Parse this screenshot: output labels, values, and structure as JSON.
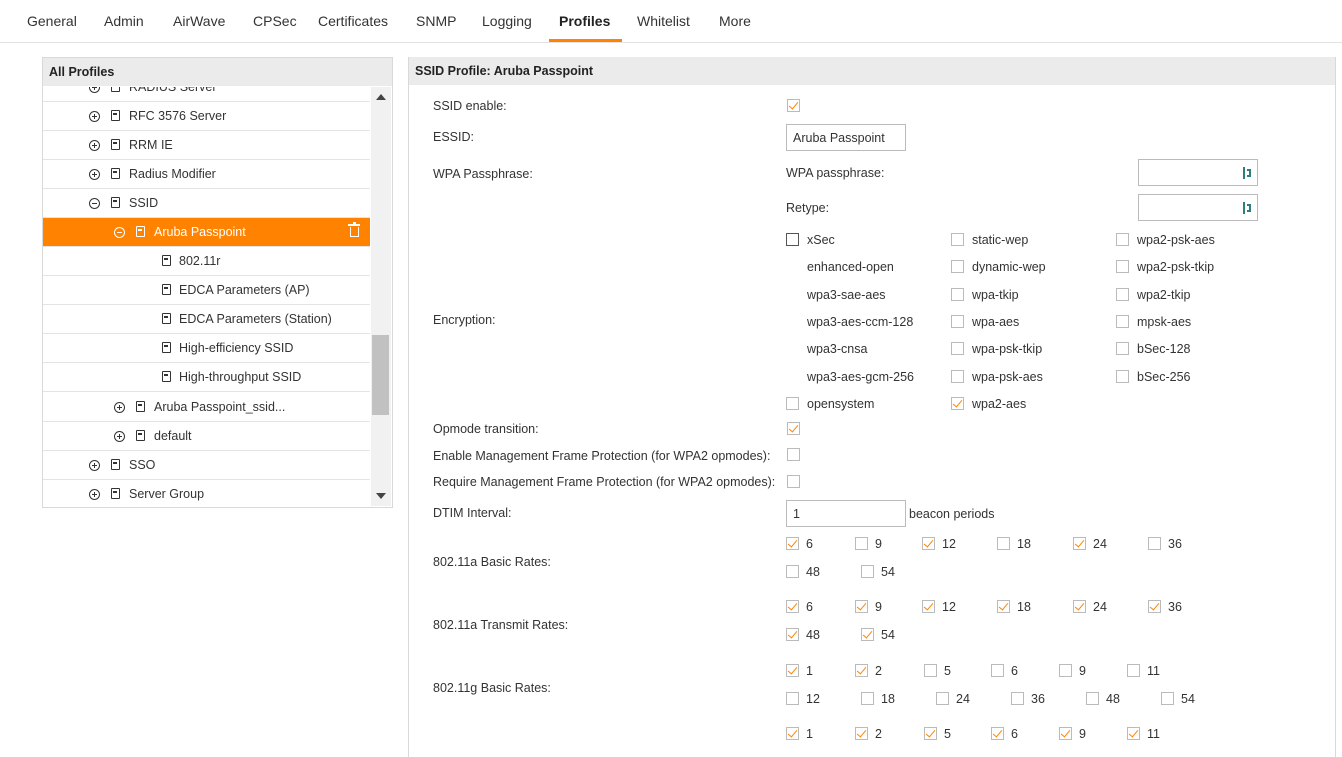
{
  "tabs": [
    "General",
    "Admin",
    "AirWave",
    "CPSec",
    "Certificates",
    "SNMP",
    "Logging",
    "Profiles",
    "Whitelist",
    "More"
  ],
  "active_tab": "Profiles",
  "colors": {
    "accent": "#ff8300",
    "check": "#ff8300",
    "panel_header": "#ebebeb"
  },
  "left_panel": {
    "title": "All Profiles",
    "tree": [
      {
        "label": "RADIUS Server",
        "expander": "plus",
        "partial": true
      },
      {
        "label": "RFC 3576 Server",
        "expander": "plus"
      },
      {
        "label": "RRM IE",
        "expander": "plus"
      },
      {
        "label": "Radius Modifier",
        "expander": "plus"
      },
      {
        "label": "SSID",
        "expander": "minus"
      },
      {
        "label": "Aruba Passpoint",
        "expander": "minus",
        "selected": true
      },
      {
        "label": "802.11r",
        "expander": "none"
      },
      {
        "label": "EDCA Parameters (AP)",
        "expander": "none"
      },
      {
        "label": "EDCA Parameters (Station)",
        "expander": "none"
      },
      {
        "label": "High-efficiency SSID",
        "expander": "none"
      },
      {
        "label": "High-throughput SSID",
        "expander": "none"
      },
      {
        "label": "Aruba Passpoint_ssid...",
        "expander": "plus"
      },
      {
        "label": "default",
        "expander": "plus"
      },
      {
        "label": "SSO",
        "expander": "plus"
      },
      {
        "label": "Server Group",
        "expander": "plus"
      }
    ]
  },
  "right_panel": {
    "title": "SSID Profile: Aruba Passpoint",
    "ssid_enable": {
      "label": "SSID enable:",
      "checked": true
    },
    "essid": {
      "label": "ESSID:",
      "value": "Aruba Passpoint"
    },
    "wpa": {
      "label": "WPA Passphrase:",
      "passphrase_label": "WPA passphrase:",
      "retype_label": "Retype:"
    },
    "encryption": {
      "label": "Encryption:",
      "options": [
        {
          "name": "xSec",
          "has_checkbox": true,
          "checked": false
        },
        {
          "name": "static-wep",
          "has_checkbox": true,
          "checked": false
        },
        {
          "name": "wpa2-psk-aes",
          "has_checkbox": true,
          "checked": false
        },
        {
          "name": "enhanced-open",
          "has_checkbox": false,
          "checked": false
        },
        {
          "name": "dynamic-wep",
          "has_checkbox": true,
          "checked": false
        },
        {
          "name": "wpa2-psk-tkip",
          "has_checkbox": true,
          "checked": false
        },
        {
          "name": "wpa3-sae-aes",
          "has_checkbox": false,
          "checked": false
        },
        {
          "name": "wpa-tkip",
          "has_checkbox": true,
          "checked": false
        },
        {
          "name": "wpa2-tkip",
          "has_checkbox": true,
          "checked": false
        },
        {
          "name": "wpa3-aes-ccm-128",
          "has_checkbox": false,
          "checked": false
        },
        {
          "name": "wpa-aes",
          "has_checkbox": true,
          "checked": false
        },
        {
          "name": "mpsk-aes",
          "has_checkbox": true,
          "checked": false
        },
        {
          "name": "wpa3-cnsa",
          "has_checkbox": false,
          "checked": false
        },
        {
          "name": "wpa-psk-tkip",
          "has_checkbox": true,
          "checked": false
        },
        {
          "name": "bSec-128",
          "has_checkbox": true,
          "checked": false
        },
        {
          "name": "wpa3-aes-gcm-256",
          "has_checkbox": false,
          "checked": false
        },
        {
          "name": "wpa-psk-aes",
          "has_checkbox": true,
          "checked": false
        },
        {
          "name": "bSec-256",
          "has_checkbox": true,
          "checked": false
        },
        {
          "name": "opensystem",
          "has_checkbox": true,
          "checked": false
        },
        {
          "name": "wpa2-aes",
          "has_checkbox": true,
          "checked": true
        }
      ]
    },
    "opmode_transition": {
      "label": "Opmode transition:",
      "checked": true
    },
    "mfp_enable": {
      "label": "Enable Management Frame Protection (for WPA2 opmodes):",
      "checked": false
    },
    "mfp_require": {
      "label": "Require Management Frame Protection (for WPA2 opmodes):",
      "checked": false
    },
    "dtim": {
      "label": "DTIM Interval:",
      "value": "1",
      "suffix": "beacon periods"
    },
    "a_basic": {
      "label": "802.11a Basic Rates:",
      "rates": [
        {
          "v": "6",
          "c": true
        },
        {
          "v": "9",
          "c": false
        },
        {
          "v": "12",
          "c": true
        },
        {
          "v": "18",
          "c": false
        },
        {
          "v": "24",
          "c": true
        },
        {
          "v": "36",
          "c": false
        },
        {
          "v": "48",
          "c": false
        },
        {
          "v": "54",
          "c": false
        }
      ]
    },
    "a_tx": {
      "label": "802.11a Transmit Rates:",
      "rates": [
        {
          "v": "6",
          "c": true
        },
        {
          "v": "9",
          "c": true
        },
        {
          "v": "12",
          "c": true
        },
        {
          "v": "18",
          "c": true
        },
        {
          "v": "24",
          "c": true
        },
        {
          "v": "36",
          "c": true
        },
        {
          "v": "48",
          "c": true
        },
        {
          "v": "54",
          "c": true
        }
      ]
    },
    "g_basic": {
      "label": "802.11g Basic Rates:",
      "rates": [
        {
          "v": "1",
          "c": true
        },
        {
          "v": "2",
          "c": true
        },
        {
          "v": "5",
          "c": false
        },
        {
          "v": "6",
          "c": false
        },
        {
          "v": "9",
          "c": false
        },
        {
          "v": "11",
          "c": false
        },
        {
          "v": "12",
          "c": false
        },
        {
          "v": "18",
          "c": false
        },
        {
          "v": "24",
          "c": false
        },
        {
          "v": "36",
          "c": false
        },
        {
          "v": "48",
          "c": false
        },
        {
          "v": "54",
          "c": false
        }
      ]
    },
    "g_tx": {
      "rates": [
        {
          "v": "1",
          "c": true
        },
        {
          "v": "2",
          "c": true
        },
        {
          "v": "5",
          "c": true
        },
        {
          "v": "6",
          "c": true
        },
        {
          "v": "9",
          "c": true
        },
        {
          "v": "11",
          "c": true
        }
      ]
    }
  }
}
